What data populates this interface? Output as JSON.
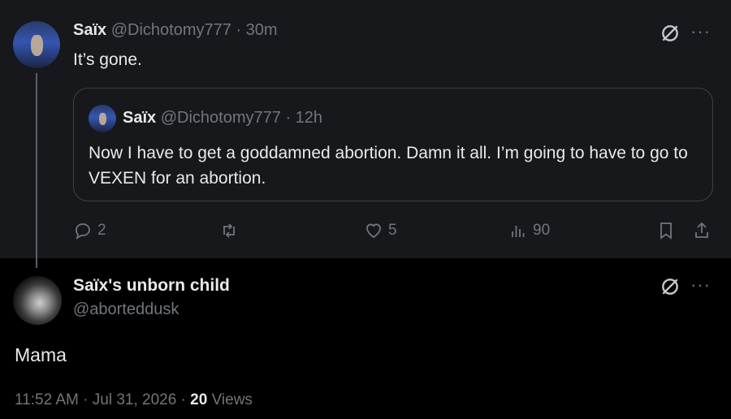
{
  "tweet1": {
    "author_name": "Saïx",
    "author_handle": "@Dichotomy777",
    "separator": "·",
    "time": "30m",
    "text": "It’s gone."
  },
  "quote": {
    "author_name": "Saïx",
    "author_handle": "@Dichotomy777",
    "separator": "·",
    "time": "12h",
    "text": "Now I have to get a goddamned abortion. Damn it all. I’m going to have to go to VEXEN for an abortion."
  },
  "actions": {
    "replies": "2",
    "likes": "5",
    "views": "90"
  },
  "tweet2": {
    "author_name": "Saïx's unborn child",
    "author_handle": "@aborteddusk",
    "text": "Mama",
    "timestamp": "11:52 AM · Jul 31, 2026 ·",
    "view_count": "20",
    "views_label": "Views"
  },
  "icons": {
    "more": "···",
    "grok": "grok-icon",
    "reply": "reply-icon",
    "retweet": "retweet-icon",
    "like": "heart-icon",
    "views": "views-icon",
    "bookmark": "bookmark-icon",
    "share": "share-icon"
  }
}
